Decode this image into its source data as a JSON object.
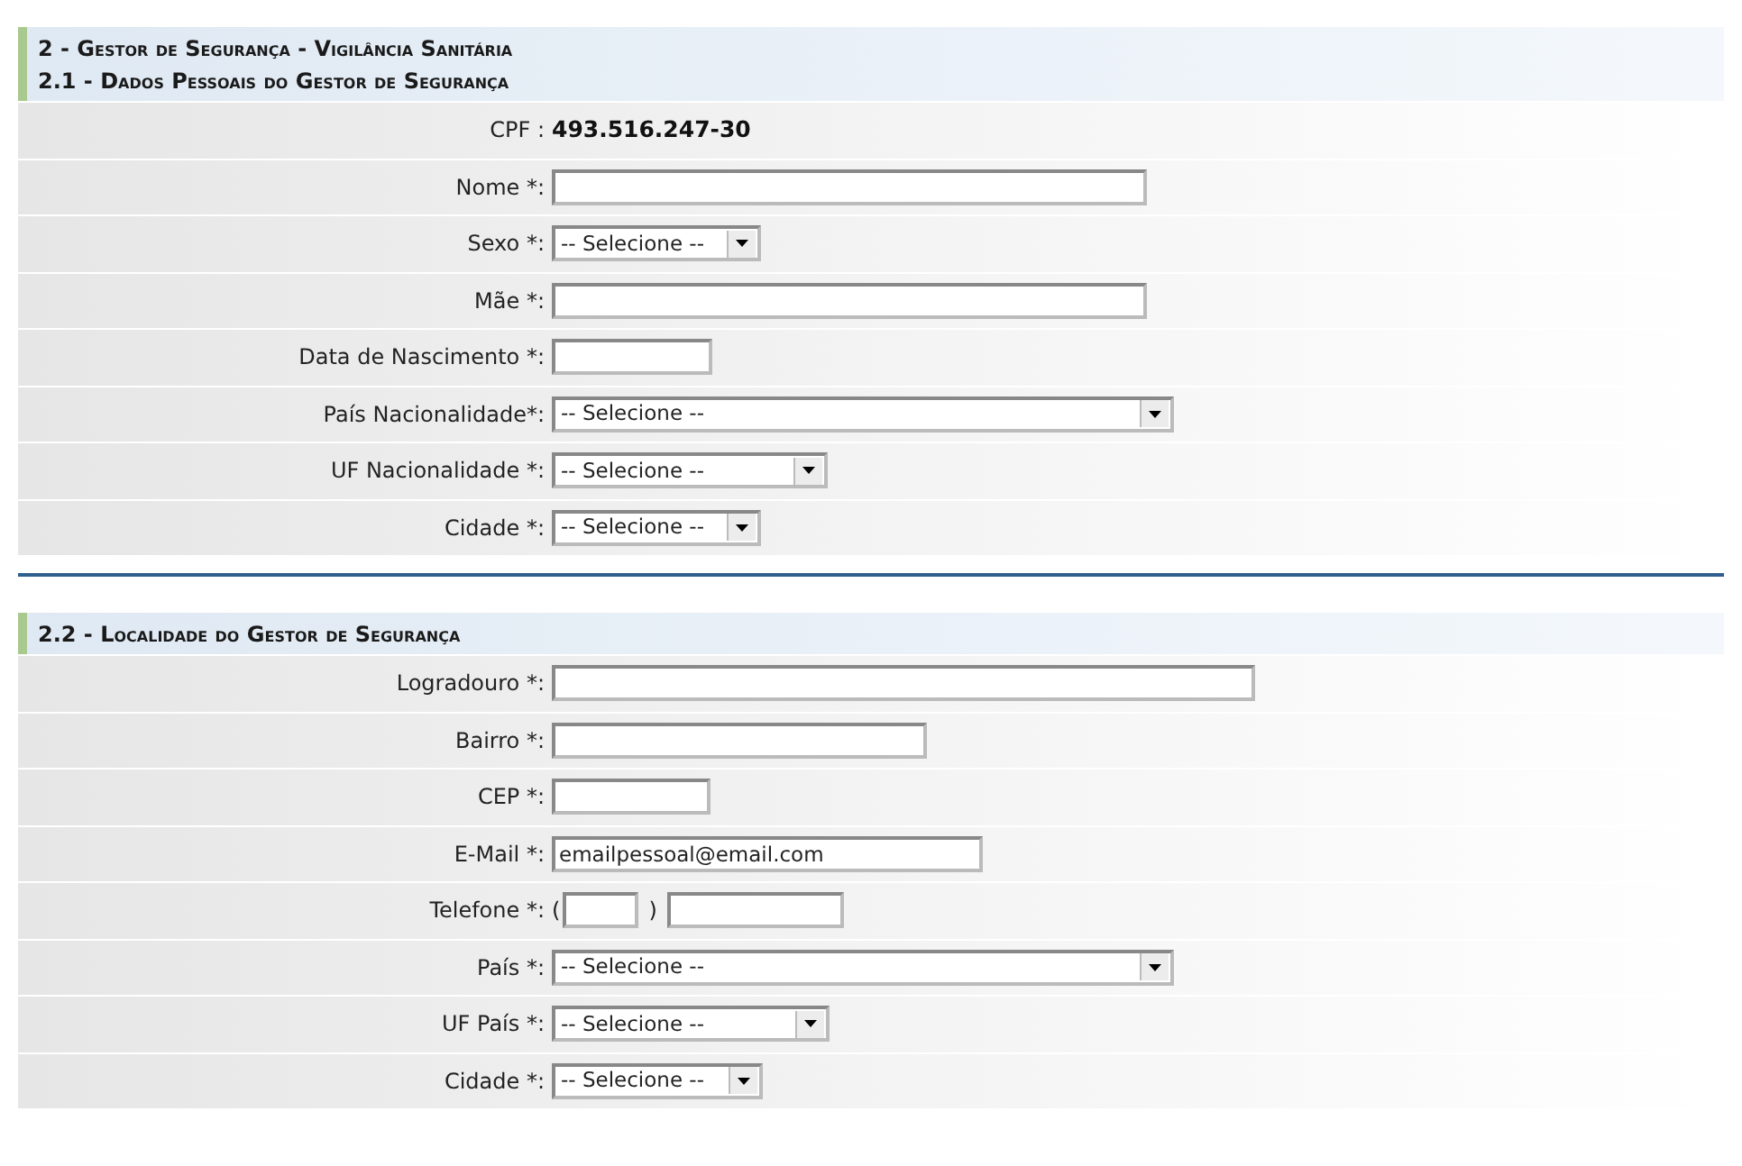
{
  "heading": "2 - Gestor de Segurança - Vigilância Sanitária",
  "sections": [
    {
      "title": "2.1 - Dados Pessoais do Gestor de Segurança",
      "fields": [
        {
          "kind": "static",
          "label": "CPF :",
          "value": "493.516.247-30"
        },
        {
          "kind": "text",
          "label": "Nome *:"
        },
        {
          "kind": "select",
          "label": "Sexo *:",
          "value": "-- Selecione --"
        },
        {
          "kind": "text",
          "label": "Mãe *:"
        },
        {
          "kind": "text",
          "label": "Data de Nascimento *:"
        },
        {
          "kind": "select",
          "label": "País Nacionalidade*:",
          "value": "-- Selecione --"
        },
        {
          "kind": "select",
          "label": "UF Nacionalidade *:",
          "value": "-- Selecione --"
        },
        {
          "kind": "select",
          "label": "Cidade *:",
          "value": "-- Selecione --"
        }
      ]
    },
    {
      "title": "2.2 - Localidade do Gestor de Segurança",
      "fields": [
        {
          "kind": "text",
          "label": "Logradouro *:"
        },
        {
          "kind": "text",
          "label": "Bairro *:"
        },
        {
          "kind": "text",
          "label": "CEP *:"
        },
        {
          "kind": "text",
          "label": "E-Mail *:",
          "value": "emailpessoal@email.com"
        },
        {
          "kind": "phone",
          "label": "Telefone *:",
          "open": "(",
          "close": ")"
        },
        {
          "kind": "select",
          "label": "País *:",
          "value": "-- Selecione --"
        },
        {
          "kind": "select",
          "label": "UF País *:",
          "value": "-- Selecione --"
        },
        {
          "kind": "select",
          "label": "Cidade *:",
          "value": "-- Selecione --"
        }
      ]
    }
  ]
}
